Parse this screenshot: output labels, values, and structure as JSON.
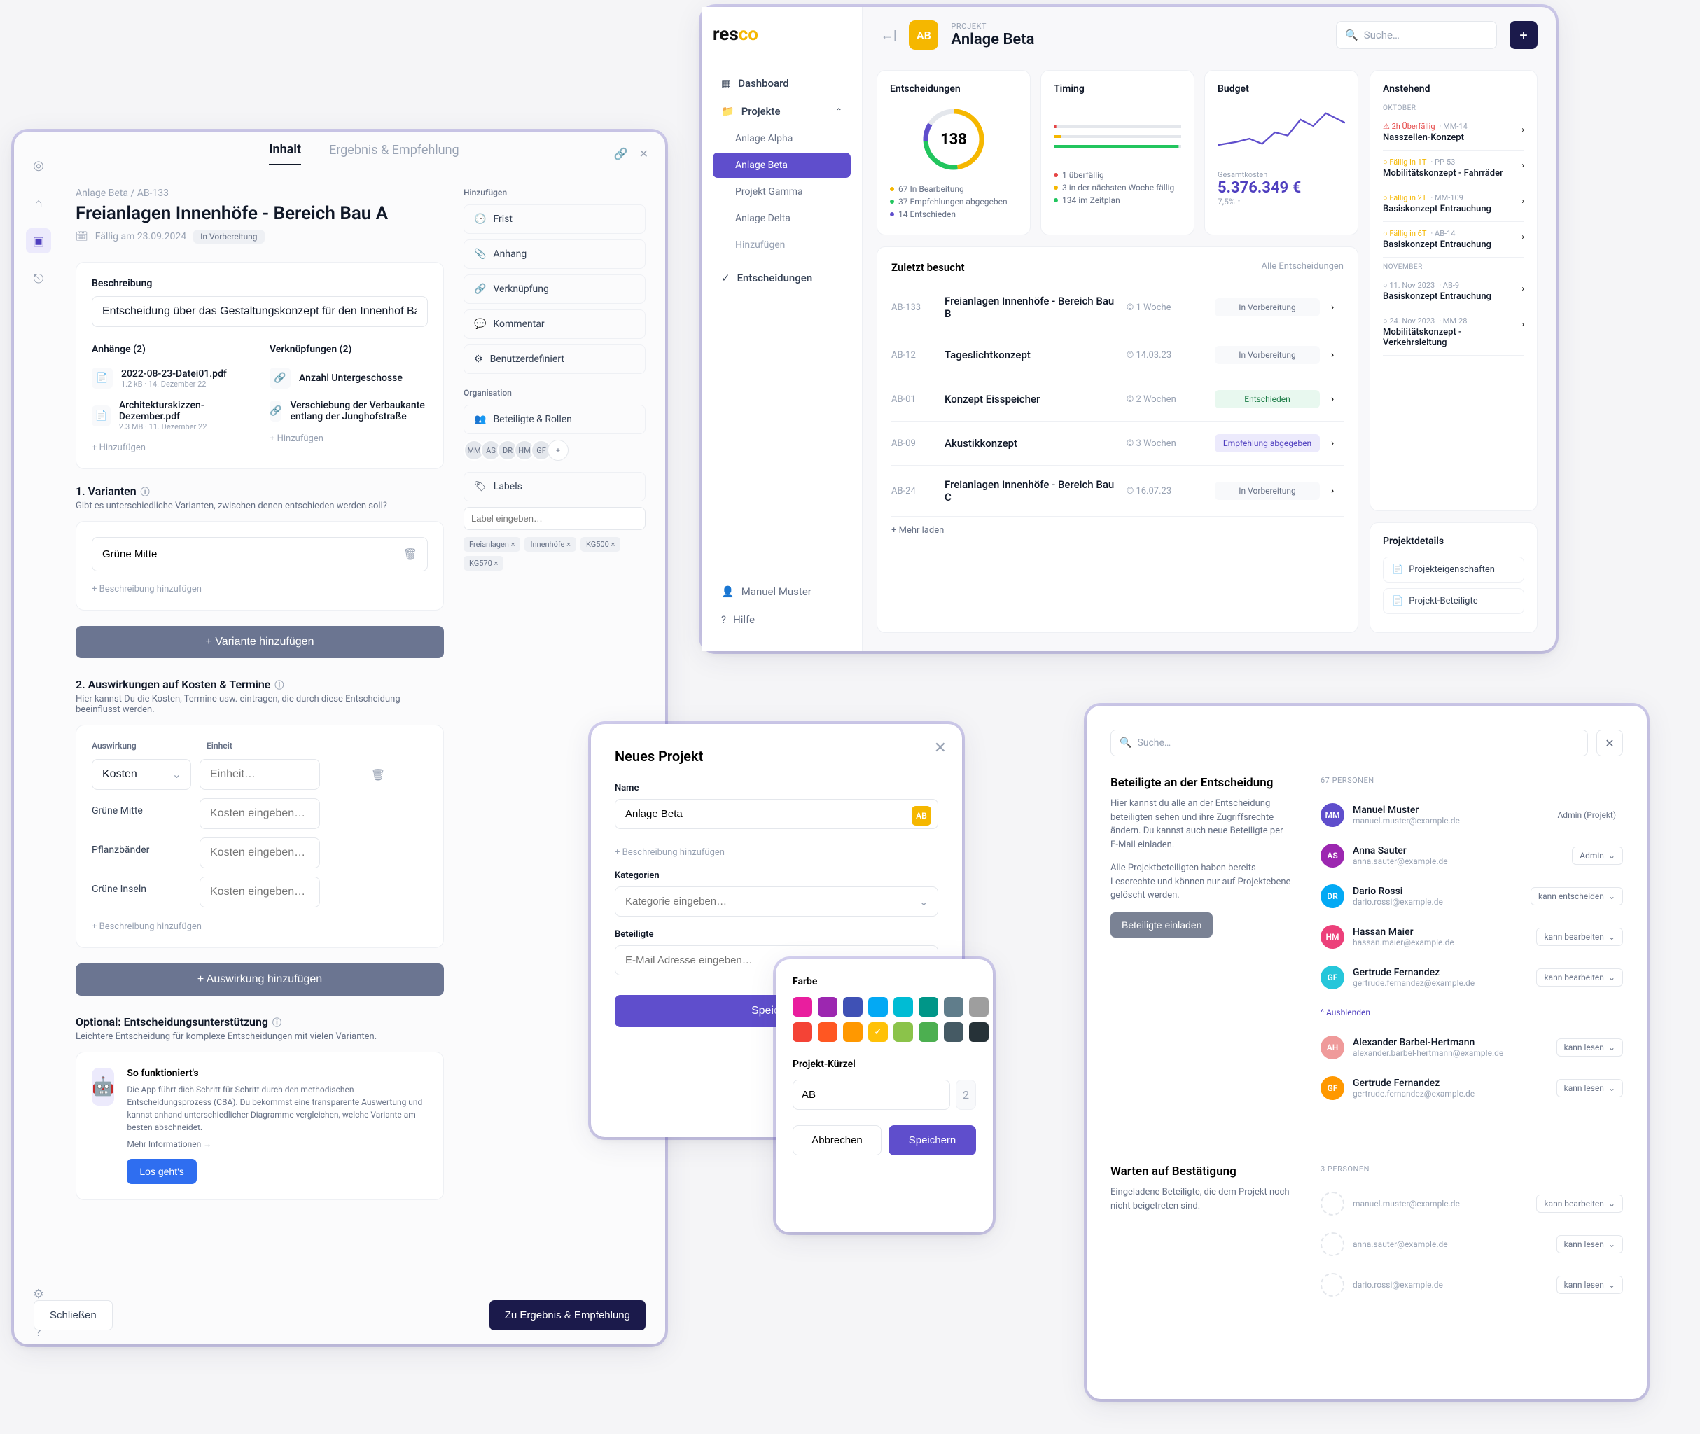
{
  "panel1": {
    "tabs": {
      "content": "Inhalt",
      "result": "Ergebnis & Empfehlung"
    },
    "breadcrumb": "Anlage Beta  /  AB-133",
    "title": "Freianlagen Innenhöfe - Bereich Bau A",
    "due": "Fällig am 23.09.2024",
    "status": "In Vorbereitung",
    "description_label": "Beschreibung",
    "description_value": "Entscheidung über das Gestaltungskonzept für den Innenhof Bau A",
    "attachments_label": "Anhänge (2)",
    "attachments": [
      {
        "name": "2022-08-23-Datei01.pdf",
        "meta": "1.2 kB · 14. Dezember 22"
      },
      {
        "name": "Architekturskizzen-Dezember.pdf",
        "meta": "2.3 MB · 11. Dezember 22"
      }
    ],
    "links_label": "Verknüpfungen (2)",
    "links": [
      {
        "name": "Anzahl Untergeschosse",
        "meta": ""
      },
      {
        "name": "Verschiebung der Verbaukante entlang der Junghofstraße",
        "meta": ""
      }
    ],
    "add": "+ Hinzufügen",
    "section1_title": "1. Varianten",
    "section1_desc": "Gibt es unterschiedliche Varianten, zwischen denen entschieden werden soll?",
    "variant_value": "Grüne Mitte",
    "add_desc": "+ Beschreibung hinzufügen",
    "add_variant_btn": "+   Variante hinzufügen",
    "section2_title": "2. Auswirkungen auf Kosten & Termine",
    "section2_desc": "Hier kannst Du die Kosten, Termine usw. eintragen, die durch diese Entscheidung beeinflusst werden.",
    "impact_hdr": "Auswirkung",
    "unit_hdr": "Einheit",
    "impact_value": "Kosten",
    "unit_placeholder": "Einheit…",
    "effect_rows": [
      "Grüne Mitte",
      "Pflanzbänder",
      "Grüne Inseln"
    ],
    "effect_ph": "Kosten eingeben…",
    "add_effect_btn": "+   Auswirkung hinzufügen",
    "section3_title": "Optional: Entscheidungsunterstützung",
    "section3_desc": "Leichtere Entscheidung für komplexe Entscheidungen mit vielen Varianten.",
    "info_title": "So funktioniert's",
    "info_body": "Die App führt dich Schritt für Schritt durch den methodischen Entscheidungsprozess (CBA). Du bekommst eine transparente Auswertung und kannst anhand unterschiedlicher Diagramme vergleichen, welche Variante am besten abschneidet.",
    "more_info": "Mehr Informationen →",
    "lets_go": "Los geht's",
    "footer_close": "Schließen",
    "footer_next": "Zu Ergebnis & Empfehlung",
    "side": {
      "add_title": "Hinzufügen",
      "add_items": [
        "Frist",
        "Anhang",
        "Verknüpfung",
        "Kommentar",
        "Benutzerdefiniert"
      ],
      "org_title": "Organisation",
      "roles_label": "Beteiligte & Rollen",
      "labels_label": "Labels",
      "label_ph": "Label eingeben…",
      "tags": [
        "Freianlagen",
        "Innenhöfe",
        "KG500",
        "KG570"
      ]
    }
  },
  "panel2": {
    "logo": "resco",
    "nav": {
      "dashboard": "Dashboard",
      "projects": "Projekte",
      "subs": [
        "Anlage Alpha",
        "Anlage Beta",
        "Projekt Gamma",
        "Anlage Delta"
      ],
      "add": "Hinzufügen",
      "decisions": "Entscheidungen",
      "user": "Manuel Muster",
      "help": "Hilfe"
    },
    "header": {
      "project_lbl": "PROJEKT",
      "project_name": "Anlage Beta",
      "badge": "AB",
      "search_ph": "Suche…"
    },
    "stats": {
      "entscheidungen": {
        "title": "Entscheidungen",
        "center": "138",
        "items": [
          {
            "color": "#f5b700",
            "text": "67 In Bearbeitung"
          },
          {
            "color": "#22c55e",
            "text": "37 Empfehlungen abgegeben"
          },
          {
            "color": "#5f4ecc",
            "text": "14 Entschieden"
          }
        ]
      },
      "timing": {
        "title": "Timing",
        "items": [
          {
            "color": "#e54545",
            "text": "1 überfällig"
          },
          {
            "color": "#f5b700",
            "text": "3 in der nächsten Woche fällig"
          },
          {
            "color": "#22c55e",
            "text": "134 im Zeitplan"
          }
        ]
      },
      "budget": {
        "title": "Budget",
        "sub": "Gesamtkosten",
        "value": "5.376.349 €",
        "pct": "7,5% ↑"
      }
    },
    "recent": {
      "title": "Zuletzt besucht",
      "all": "Alle Entscheidungen",
      "rows": [
        {
          "id": "AB-133",
          "name": "Freianlagen Innenhöfe - Bereich Bau B",
          "time": "© 1 Woche",
          "badge": "In Vorbereitung",
          "cls": ""
        },
        {
          "id": "AB-12",
          "name": "Tageslichtkonzept",
          "time": "© 14.03.23",
          "badge": "In Vorbereitung",
          "cls": ""
        },
        {
          "id": "AB-01",
          "name": "Konzept Eisspeicher",
          "time": "© 2 Wochen",
          "badge": "Entschieden",
          "cls": "green"
        },
        {
          "id": "AB-09",
          "name": "Akustikkonzept",
          "time": "© 3 Wochen",
          "badge": "Empfehlung abgegeben",
          "cls": "violet"
        },
        {
          "id": "AB-24",
          "name": "Freianlagen Innenhöfe - Bereich Bau C",
          "time": "© 16.07.23",
          "badge": "In Vorbereitung",
          "cls": ""
        }
      ],
      "more": "+  Mehr laden"
    },
    "pending": {
      "title": "Anstehend",
      "months": [
        {
          "name": "OKTOBER",
          "items": [
            {
              "cls": "red",
              "due": "⚠ 2h Überfällig",
              "ref": "MM-14",
              "name": "Nasszellen-Konzept"
            },
            {
              "cls": "amber",
              "due": "○ Fällig in 1T",
              "ref": "PP-53",
              "name": "Mobilitätskonzept - Fahrräder"
            },
            {
              "cls": "amber",
              "due": "○ Fällig in 2T",
              "ref": "MM-109",
              "name": "Basiskonzept Entrauchung"
            },
            {
              "cls": "amber",
              "due": "○ Fällig in 6T",
              "ref": "AB-14",
              "name": "Basiskonzept Entrauchung"
            }
          ]
        },
        {
          "name": "NOVEMBER",
          "items": [
            {
              "cls": "",
              "due": "○ 11. Nov 2023",
              "ref": "AB-9",
              "name": "Basiskonzept Entrauchung"
            },
            {
              "cls": "",
              "due": "○ 24. Nov 2023",
              "ref": "MM-28",
              "name": "Mobilitätskonzept - Verkehrsleitung"
            }
          ]
        }
      ]
    },
    "details": {
      "title": "Projektdetails",
      "links": [
        "Projekteigenschaften",
        "Projekt-Beteiligte"
      ]
    }
  },
  "panel3": {
    "title": "Neues Projekt",
    "name_lbl": "Name",
    "name_val": "Anlage Beta",
    "badge": "AB",
    "add_desc": "+  Beschreibung hinzufügen",
    "cat_lbl": "Kategorien",
    "cat_ph": "Kategorie eingeben…",
    "ppl_lbl": "Beteiligte",
    "ppl_ph": "E-Mail Adresse eingeben…",
    "save": "Speichern"
  },
  "panel4": {
    "color_lbl": "Farbe",
    "colors": [
      "#e91e9e",
      "#9c27b0",
      "#3f51b5",
      "#03a9f4",
      "#00bcd4",
      "#009688",
      "#607d8b",
      "#9e9e9e",
      "#f44336",
      "#ff5722",
      "#ff9800",
      "#ffc107",
      "#8bc34a",
      "#4caf50",
      "#455a64",
      "#263238"
    ],
    "selected_idx": 11,
    "kurz_lbl": "Projekt-Kürzel",
    "kurz_val": "AB",
    "kurz_len": "2",
    "cancel": "Abbrechen",
    "save": "Speichern"
  },
  "panel5": {
    "search_ph": "Suche…",
    "left1_title": "Beteiligte an der Entscheidung",
    "left1_p1": "Hier kannst du alle an der Entscheidung beteiligten sehen und ihre Zugriffsrechte ändern. Du kannst auch neue Beteiligte per E-Mail einladen.",
    "left1_p2": "Alle Projektbeteiligten haben bereits Leserechte und können nur auf Projektebene gelöscht werden.",
    "invite_btn": "Beteiligte einladen",
    "count": "67 PERSONEN",
    "people": [
      {
        "init": "MM",
        "color": "#5f4ecc",
        "name": "Manuel Muster",
        "mail": "manuel.muster@example.de",
        "role": "Admin (Projekt)",
        "plain": true
      },
      {
        "init": "AS",
        "color": "#9c27b0",
        "name": "Anna Sauter",
        "mail": "anna.sauter@example.de",
        "role": "Admin"
      },
      {
        "init": "DR",
        "color": "#03a9f4",
        "name": "Dario Rossi",
        "mail": "dario.rossi@example.de",
        "role": "kann entscheiden"
      },
      {
        "init": "HM",
        "color": "#ec407a",
        "name": "Hassan Maier",
        "mail": "hassan.maier@example.de",
        "role": "kann bearbeiten"
      },
      {
        "init": "GF",
        "color": "#26c6da",
        "name": "Gertrude Fernandez",
        "mail": "gertrude.fernandez@example.de",
        "role": "kann bearbeiten"
      }
    ],
    "collapse": "^  Ausblenden",
    "people2": [
      {
        "init": "AH",
        "color": "#ef9a9a",
        "name": "Alexander Barbel-Hertmann",
        "mail": "alexander.barbel-hertmann@example.de",
        "role": "kann lesen"
      },
      {
        "init": "GF",
        "color": "#ff9800",
        "name": "Gertrude Fernandez",
        "mail": "gertrude.fernandez@example.de",
        "role": "kann lesen"
      }
    ],
    "left2_title": "Warten auf Bestätigung",
    "left2_p": "Eingeladene Beteiligte, die dem Projekt noch nicht beigetreten sind.",
    "count2": "3 PERSONEN",
    "pending": [
      {
        "mail": "manuel.muster@example.de",
        "role": "kann bearbeiten"
      },
      {
        "mail": "anna.sauter@example.de",
        "role": "kann lesen"
      },
      {
        "mail": "dario.rossi@example.de",
        "role": "kann lesen"
      }
    ]
  }
}
